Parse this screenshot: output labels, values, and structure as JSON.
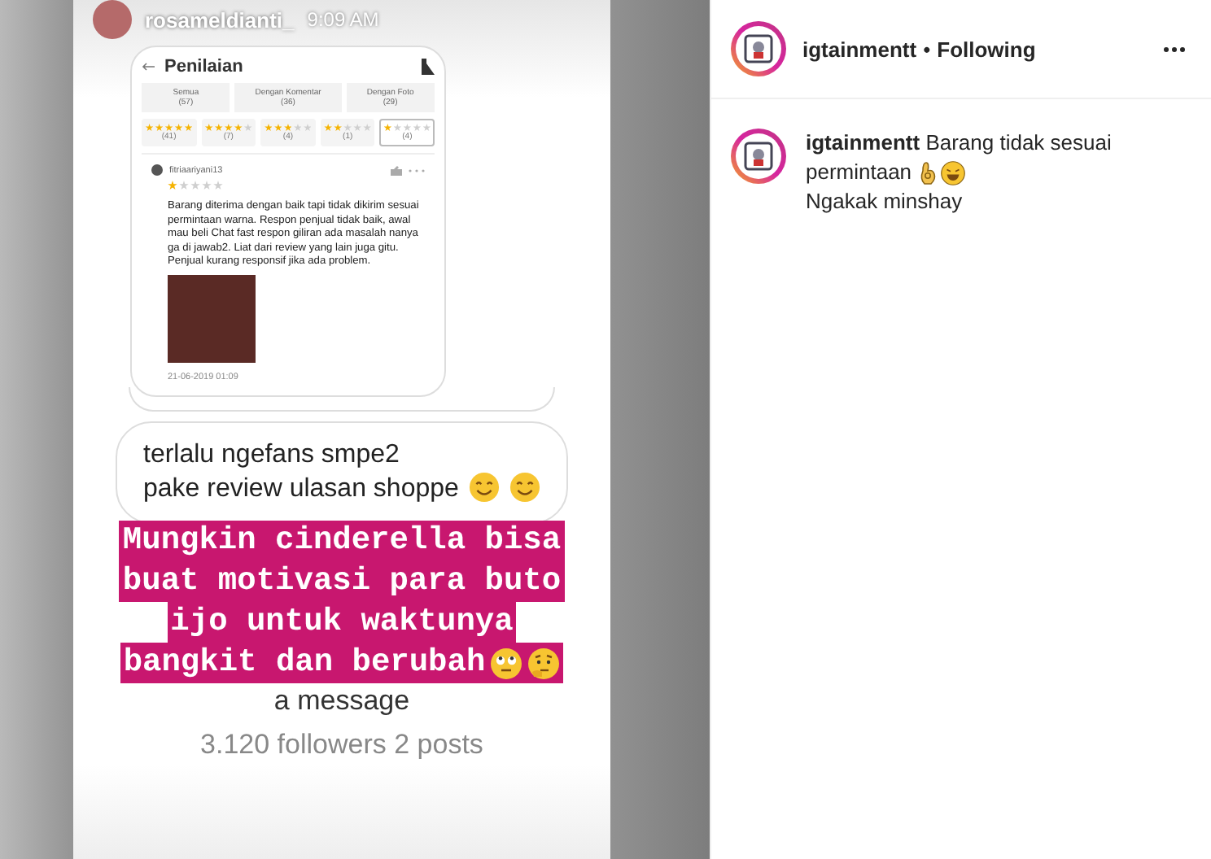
{
  "story": {
    "username": "rosameldianti_",
    "time": "9:09 AM",
    "review_screen": {
      "title": "Penilaian",
      "tabs": [
        {
          "label": "Semua",
          "count": "(57)"
        },
        {
          "label": "Dengan Komentar",
          "count": "(36)"
        },
        {
          "label": "Dengan Foto",
          "count": "(29)"
        }
      ],
      "star_filters": [
        {
          "stars": 5,
          "count": "(41)",
          "selected": false
        },
        {
          "stars": 4,
          "count": "(7)",
          "selected": false
        },
        {
          "stars": 3,
          "count": "(4)",
          "selected": false
        },
        {
          "stars": 2,
          "count": "(1)",
          "selected": false
        },
        {
          "stars": 1,
          "count": "(4)",
          "selected": true
        }
      ],
      "review": {
        "user": "fitriaariyani13",
        "stars": 1,
        "text": "Barang diterima dengan baik tapi tidak dikirim sesuai permintaan warna. Respon penjual tidak baik, awal mau beli Chat fast respon giliran ada masalah nanya ga di jawab2. Liat dari review yang lain juga gitu. Penjual kurang responsif jika ada problem.",
        "date": "21-06-2019 01:09"
      }
    },
    "message_bubble": "terlalu ngefans smpe2 pake review ulasan shoppe",
    "caption_lines": [
      "Mungkin cinderella bisa",
      "buat motivasi para buto",
      "ijo untuk waktunya",
      "bangkit dan berubah"
    ],
    "reply_hint": "a message",
    "profile_stats": "3.120 followers 2 posts"
  },
  "post_header": {
    "username": "igtainmentt",
    "separator": "•",
    "follow_state": "Following"
  },
  "comment": {
    "username": "igtainmentt",
    "text": "Barang tidak sesuai permintaan",
    "second_line": "Ngakak minshay"
  }
}
